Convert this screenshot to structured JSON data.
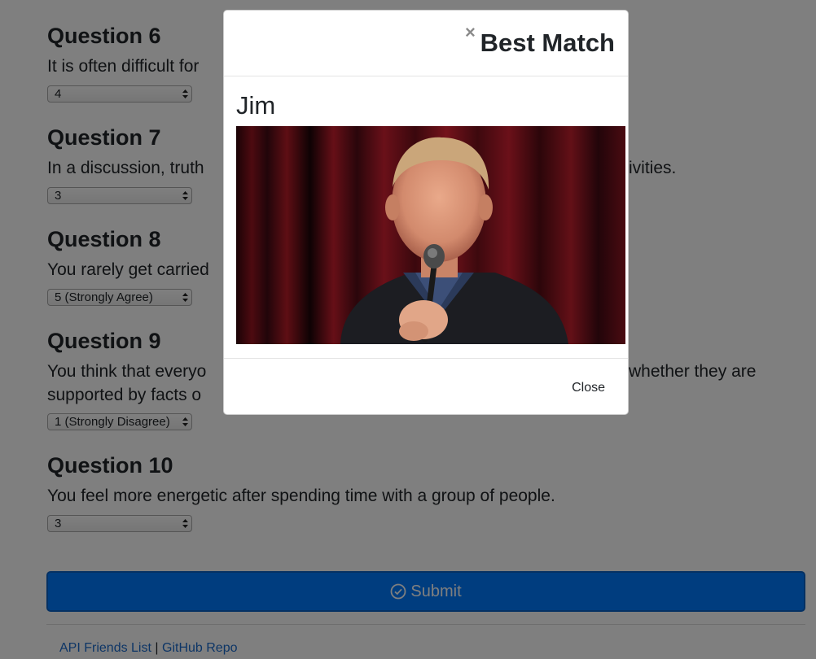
{
  "questions": [
    {
      "title": "Question 6",
      "text": "It is often difficult for",
      "answer": "4"
    },
    {
      "title": "Question 7",
      "text": "In a discussion, truth",
      "text_right": "ivities.",
      "answer": "3"
    },
    {
      "title": "Question 8",
      "text": "You rarely get carried",
      "answer": "5 (Strongly Agree)"
    },
    {
      "title": "Question 9",
      "text_lines": [
        "You think that everyo",
        "supported by facts o"
      ],
      "text_right": "whether they are",
      "answer": "1 (Strongly Disagree)"
    },
    {
      "title": "Question 10",
      "text": "You feel more energetic after spending time with a group of people.",
      "answer": "3"
    }
  ],
  "submit": {
    "label": "Submit",
    "color": "#007bff",
    "icon": "check-circle-icon"
  },
  "footer": {
    "links": [
      "API Friends List",
      "GitHub Repo"
    ],
    "separator": "|"
  },
  "modal": {
    "title": "Best Match",
    "close_icon": "×",
    "match_name": "Jim",
    "close_button": "Close"
  },
  "colors": {
    "backdrop": "rgba(0,0,0,0.5)",
    "link": "#1a6bcc"
  }
}
